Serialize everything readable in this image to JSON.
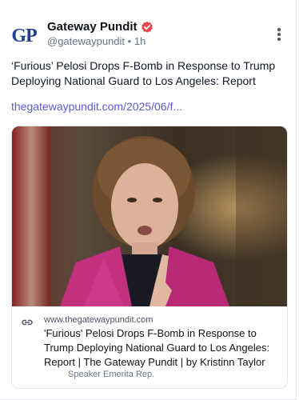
{
  "author": {
    "avatar_text": "GP",
    "display_name": "Gateway Pundit",
    "handle": "@gatewaypundit",
    "separator": "•",
    "time": "1h",
    "verified_color": "#e8484d"
  },
  "post": {
    "text": "‘Furious’ Pelosi Drops F-Bomb in Response to Trump Deploying National Guard to Los Angeles: Report",
    "link": "thegatewaypundit.com/2025/06/f..."
  },
  "preview": {
    "image_icon": "photo-of-woman-in-pink-blazer",
    "link_icon": "link-icon",
    "domain": "www.thegatewaypundit.com",
    "title": "'Furious' Pelosi Drops F-Bomb in Response to Trump Deploying National Guard to Los Angeles: Report | The Gateway Pundit | by Kristinn Taylor",
    "description": "Speaker Emerita Rep."
  },
  "menu": {
    "icon": "more-vertical-icon"
  }
}
